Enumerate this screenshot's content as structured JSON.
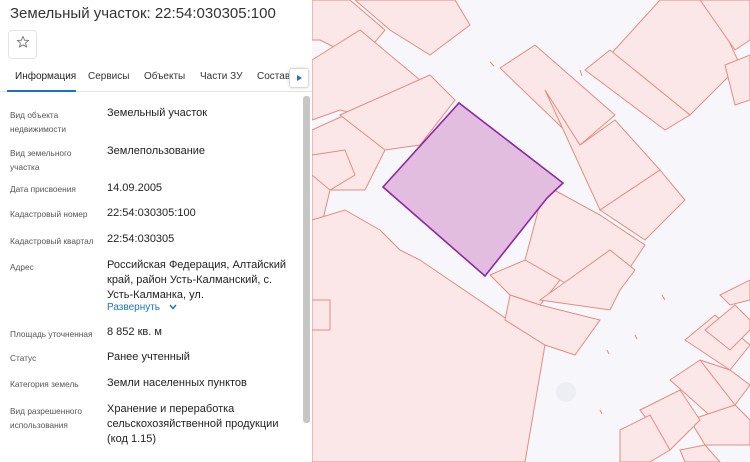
{
  "header": {
    "title": "Земельный участок: 22:54:030305:100"
  },
  "favorite": {
    "icon": "star-icon"
  },
  "tabs": [
    {
      "label": "Информация",
      "active": true
    },
    {
      "label": "Сервисы"
    },
    {
      "label": "Объекты"
    },
    {
      "label": "Части ЗУ"
    },
    {
      "label": "Состав"
    }
  ],
  "tabs_scroll": {
    "icon": "triangle-right-icon"
  },
  "info": {
    "object_type": {
      "label": "Вид объекта недвижимости",
      "value": "Земельный участок"
    },
    "land_type": {
      "label": "Вид земельного участка",
      "value": "Землепользование"
    },
    "assign_date": {
      "label": "Дата присвоения",
      "value": "14.09.2005"
    },
    "cadastral_number": {
      "label": "Кадастровый номер",
      "value": "22:54:030305:100"
    },
    "cadastral_quarter": {
      "label": "Кадастровый квартал",
      "value": "22:54:030305"
    },
    "address": {
      "label": "Адрес",
      "value": "Российская Федерация, Алтайский край, район Усть-Калманский, с. Усть-Калманка, ул.",
      "expand_label": "Развернуть",
      "expand_icon": "chevron-down-icon"
    },
    "area": {
      "label": "Площадь уточненная",
      "value": "8 852 кв. м"
    },
    "status": {
      "label": "Статус",
      "value": "Ранее учтенный"
    },
    "land_category": {
      "label": "Категория земель",
      "value": "Земли населенных пунктов"
    },
    "permitted_use": {
      "label": "Вид разрешенного использования",
      "value": "Хранение и переработка сельскохозяйственной продукции (код 1.15)"
    }
  },
  "colors": {
    "map_background": "#f6f6fb",
    "parcel_fill": "#fbe7e7",
    "parcel_stroke": "#e58c80",
    "selected_fill": "#e2bde0",
    "selected_stroke": "#8e27a3",
    "accent": "#1a73c9"
  }
}
